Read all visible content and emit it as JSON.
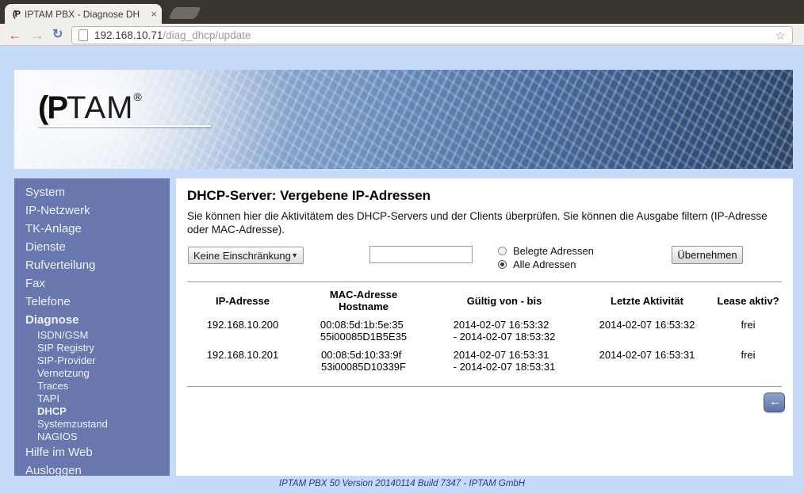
{
  "browser": {
    "tab_title": "IPTAM PBX - Diagnose DH",
    "favicon_text": "(P",
    "url_host": "192.168.10.71",
    "url_path": "/diag_dhcp/update"
  },
  "header": {
    "logo_ip": "(P",
    "logo_tam": "TAM",
    "logo_reg": "®"
  },
  "sidebar": {
    "items": [
      {
        "label": "System",
        "level": 1,
        "bold": false
      },
      {
        "label": "IP-Netzwerk",
        "level": 1,
        "bold": false
      },
      {
        "label": "TK-Anlage",
        "level": 1,
        "bold": false
      },
      {
        "label": "Dienste",
        "level": 1,
        "bold": false
      },
      {
        "label": "Rufverteilung",
        "level": 1,
        "bold": false
      },
      {
        "label": "Fax",
        "level": 1,
        "bold": false
      },
      {
        "label": "Telefone",
        "level": 1,
        "bold": false
      },
      {
        "label": "Diagnose",
        "level": 1,
        "bold": true
      },
      {
        "label": "ISDN/GSM",
        "level": 2,
        "bold": false
      },
      {
        "label": "SIP Registry",
        "level": 2,
        "bold": false
      },
      {
        "label": "SIP-Provider",
        "level": 2,
        "bold": false
      },
      {
        "label": "Vernetzung",
        "level": 2,
        "bold": false
      },
      {
        "label": "Traces",
        "level": 2,
        "bold": false
      },
      {
        "label": "TAPI",
        "level": 2,
        "bold": false
      },
      {
        "label": "DHCP",
        "level": 2,
        "bold": true
      },
      {
        "label": "Systemzustand",
        "level": 2,
        "bold": false
      },
      {
        "label": "NAGIOS",
        "level": 2,
        "bold": false
      },
      {
        "label": "Hilfe im Web",
        "level": 1,
        "bold": false
      },
      {
        "label": "Ausloggen",
        "level": 1,
        "bold": false
      }
    ]
  },
  "main": {
    "title": "DHCP-Server: Vergebene IP-Adressen",
    "description": "Sie können hier die Aktivitätem des DHCP-Servers und der Clients überprüfen. Sie können die Ausgabe filtern (IP-Adresse oder MAC-Adresse).",
    "filter": {
      "dropdown_value": "Keine Einschränkung",
      "input_value": "",
      "radios": [
        {
          "label": "Belegte Adressen",
          "selected": false
        },
        {
          "label": "Alle Adressen",
          "selected": true
        }
      ],
      "submit_label": "Übernehmen"
    },
    "table": {
      "headers": [
        {
          "lines": [
            "IP-Adresse"
          ]
        },
        {
          "lines": [
            "MAC-Adresse",
            "Hostname"
          ]
        },
        {
          "lines": [
            "Gültig von - bis"
          ]
        },
        {
          "lines": [
            "Letzte Aktivität"
          ]
        },
        {
          "lines": [
            "Lease aktiv?"
          ]
        }
      ],
      "rows": [
        {
          "ip": "192.168.10.200",
          "mac": "00:08:5d:1b:5e:35",
          "hostname": "55i00085D1B5E35",
          "valid_from": "2014-02-07 16:53:32",
          "valid_to": "- 2014-02-07 18:53:32",
          "last_activity": "2014-02-07 16:53:32",
          "lease": "frei"
        },
        {
          "ip": "192.168.10.201",
          "mac": "00:08:5d:10:33:9f",
          "hostname": "53i00085D10339F",
          "valid_from": "2014-02-07 16:53:31",
          "valid_to": "- 2014-02-07 18:53:31",
          "last_activity": "2014-02-07 16:53:31",
          "lease": "frei"
        }
      ]
    }
  },
  "footer": {
    "text": "IPTAM PBX 50 Version 20140114 Build 7347 - IPTAM GmbH"
  },
  "colors": {
    "page_background": "#c6dafa",
    "sidebar_background": "#6878ae",
    "sidebar_text": "#eef1f8",
    "content_background": "#ffffff",
    "footer_text": "#223a92",
    "tabstrip_background": "#38342e",
    "toolbar_background": "#f1efec",
    "back_arrow_orange": "#c96a2e",
    "reload_blue": "#5581c4",
    "back_button_top": "#92a4cb",
    "back_button_bottom": "#5e73a6"
  }
}
